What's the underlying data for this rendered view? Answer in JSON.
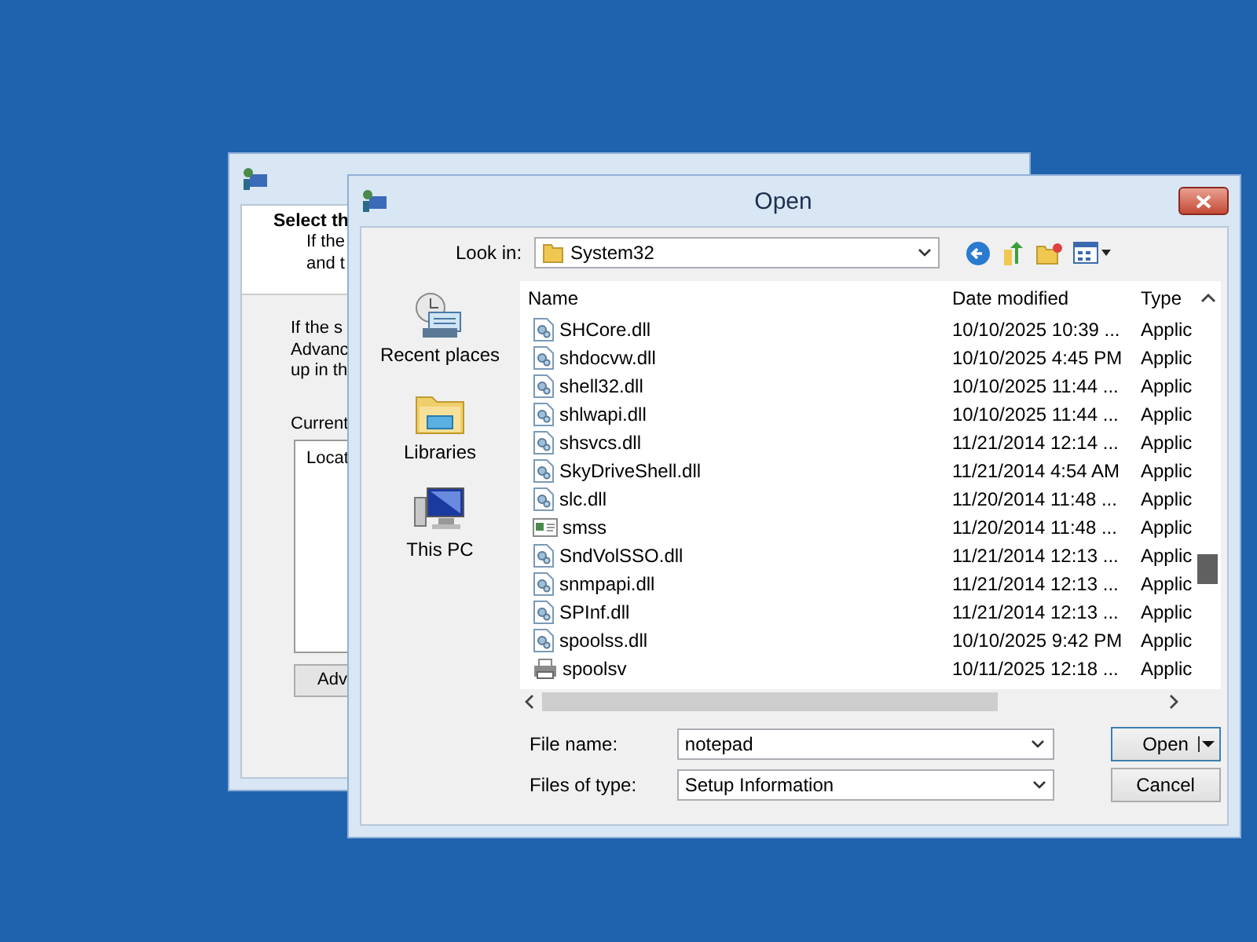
{
  "back_window": {
    "header_title": "Select th",
    "header_lines": [
      "If the",
      "and t"
    ],
    "body_lines": [
      "If the s",
      "Advanc",
      "up in th"
    ],
    "list_label": "Current",
    "list_column": "Locat",
    "button": "Adv"
  },
  "open_dialog": {
    "title": "Open",
    "look_in_label": "Look in:",
    "look_in_value": "System32",
    "places": [
      {
        "label": "Recent places",
        "kind": "recent"
      },
      {
        "label": "Libraries",
        "kind": "libraries"
      },
      {
        "label": "This PC",
        "kind": "pc"
      }
    ],
    "columns": [
      "Name",
      "Date modified",
      "Type"
    ],
    "rows": [
      {
        "name": "SHCore.dll",
        "date": "10/10/2025 10:39 ...",
        "type": "Applic",
        "kind": "dll"
      },
      {
        "name": "shdocvw.dll",
        "date": "10/10/2025 4:45 PM",
        "type": "Applic",
        "kind": "dll"
      },
      {
        "name": "shell32.dll",
        "date": "10/10/2025 11:44 ...",
        "type": "Applic",
        "kind": "dll"
      },
      {
        "name": "shlwapi.dll",
        "date": "10/10/2025 11:44 ...",
        "type": "Applic",
        "kind": "dll"
      },
      {
        "name": "shsvcs.dll",
        "date": "11/21/2014 12:14 ...",
        "type": "Applic",
        "kind": "dll"
      },
      {
        "name": "SkyDriveShell.dll",
        "date": "11/21/2014 4:54 AM",
        "type": "Applic",
        "kind": "dll"
      },
      {
        "name": "slc.dll",
        "date": "11/20/2014 11:48 ...",
        "type": "Applic",
        "kind": "dll"
      },
      {
        "name": "smss",
        "date": "11/20/2014 11:48 ...",
        "type": "Applic",
        "kind": "exe"
      },
      {
        "name": "SndVolSSO.dll",
        "date": "11/21/2014 12:13 ...",
        "type": "Applic",
        "kind": "dll"
      },
      {
        "name": "snmpapi.dll",
        "date": "11/21/2014 12:13 ...",
        "type": "Applic",
        "kind": "dll"
      },
      {
        "name": "SPInf.dll",
        "date": "11/21/2014 12:13 ...",
        "type": "Applic",
        "kind": "dll"
      },
      {
        "name": "spoolss.dll",
        "date": "10/10/2025 9:42 PM",
        "type": "Applic",
        "kind": "dll"
      },
      {
        "name": "spoolsv",
        "date": "10/11/2025 12:18 ...",
        "type": "Applic",
        "kind": "printer"
      }
    ],
    "file_name_label": "File name:",
    "file_name_value": "notepad",
    "file_type_label": "Files of type:",
    "file_type_value": "Setup Information",
    "open_button": "Open",
    "cancel_button": "Cancel"
  }
}
